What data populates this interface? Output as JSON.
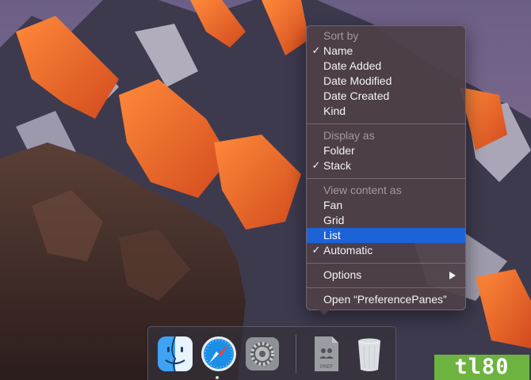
{
  "context_menu": {
    "sort_by": {
      "header": "Sort by",
      "items": [
        {
          "label": "Name",
          "checked": true
        },
        {
          "label": "Date Added",
          "checked": false
        },
        {
          "label": "Date Modified",
          "checked": false
        },
        {
          "label": "Date Created",
          "checked": false
        },
        {
          "label": "Kind",
          "checked": false
        }
      ]
    },
    "display_as": {
      "header": "Display as",
      "items": [
        {
          "label": "Folder",
          "checked": false
        },
        {
          "label": "Stack",
          "checked": true
        }
      ]
    },
    "view_content_as": {
      "header": "View content as",
      "items": [
        {
          "label": "Fan",
          "checked": false
        },
        {
          "label": "Grid",
          "checked": false
        },
        {
          "label": "List",
          "checked": false,
          "highlighted": true
        },
        {
          "label": "Automatic",
          "checked": true
        }
      ]
    },
    "options_label": "Options",
    "open_label": "Open “PreferencePanes”",
    "checkmark": "✓",
    "highlight_color": "#1d63d8"
  },
  "dock": {
    "apps": [
      {
        "icon": "finder-icon",
        "running": false
      },
      {
        "icon": "safari-icon",
        "running": true
      },
      {
        "icon": "system-preferences-icon",
        "running": false
      },
      {
        "icon": "preferencepanes-folder-icon",
        "running": false
      },
      {
        "icon": "trash-icon",
        "running": false
      }
    ],
    "pref_badge": "PREF"
  },
  "watermark": {
    "text": "tl80",
    "color": "#6db33f"
  }
}
